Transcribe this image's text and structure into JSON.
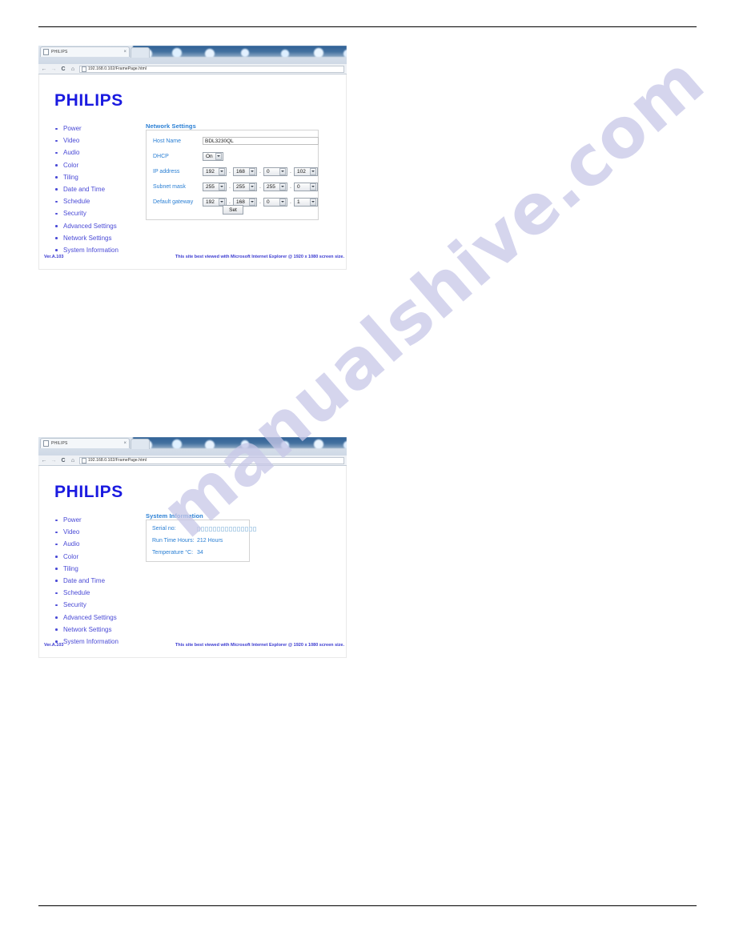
{
  "document": {
    "watermark": "manualshive.com"
  },
  "browser": {
    "tab_title": "PHILIPS",
    "tab_close_label": "×",
    "back_label": "←",
    "forward_label": "→",
    "reload_label": "C",
    "home_label": "⌂",
    "url": "192.168.0.102/FramePage.html"
  },
  "page": {
    "brand": "PHILIPS",
    "nav_items": [
      "Power",
      "Video",
      "Audio",
      "Color",
      "Tiling",
      "Date and Time",
      "Schedule",
      "Security",
      "Advanced Settings",
      "Network Settings",
      "System Information"
    ],
    "footer": {
      "version": "Ver.A.103",
      "note": "This site best viewed with Microsoft Internet Explorer @ 1920 x 1080 screen size."
    }
  },
  "network_settings": {
    "title": "Network Settings",
    "host_name_label": "Host Name",
    "host_name_value": "BDL3230QL",
    "dhcp_label": "DHCP",
    "dhcp_value": "On",
    "ip_address_label": "IP address",
    "ip_address": [
      "192",
      "168",
      "0",
      "102"
    ],
    "subnet_mask_label": "Subnet mask",
    "subnet_mask": [
      "255",
      "255",
      "255",
      "0"
    ],
    "default_gateway_label": "Default gateway",
    "default_gateway": [
      "192",
      "168",
      "0",
      "1"
    ],
    "separator": ".",
    "set_button": "Set"
  },
  "system_information": {
    "title": "System Information",
    "serial_label": "Serial no:",
    "serial_masked_count": 15,
    "run_time_label": "Run Time Hours:",
    "run_time_value": "212 Hours",
    "temperature_label": "Temperature °C:",
    "temperature_value": "34"
  }
}
